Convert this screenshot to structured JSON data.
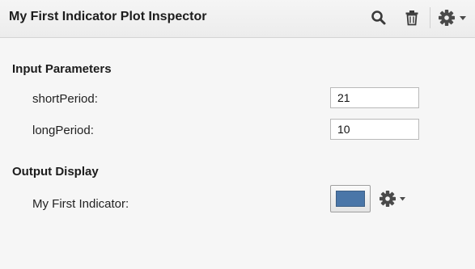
{
  "window": {
    "title": "My First Indicator Plot Inspector"
  },
  "toolbar": {
    "search_icon": "magnifier",
    "delete_icon": "trash",
    "settings_icon": "gear-with-dropdown"
  },
  "input_parameters": {
    "heading": "Input Parameters",
    "params": [
      {
        "label": "shortPeriod:",
        "value": "21"
      },
      {
        "label": "longPeriod:",
        "value": "10"
      }
    ]
  },
  "output_display": {
    "heading": "Output Display",
    "items": [
      {
        "label": "My First Indicator:",
        "color": "#4a76a8"
      }
    ]
  },
  "colors": {
    "plot_color": "#4a76a8"
  }
}
